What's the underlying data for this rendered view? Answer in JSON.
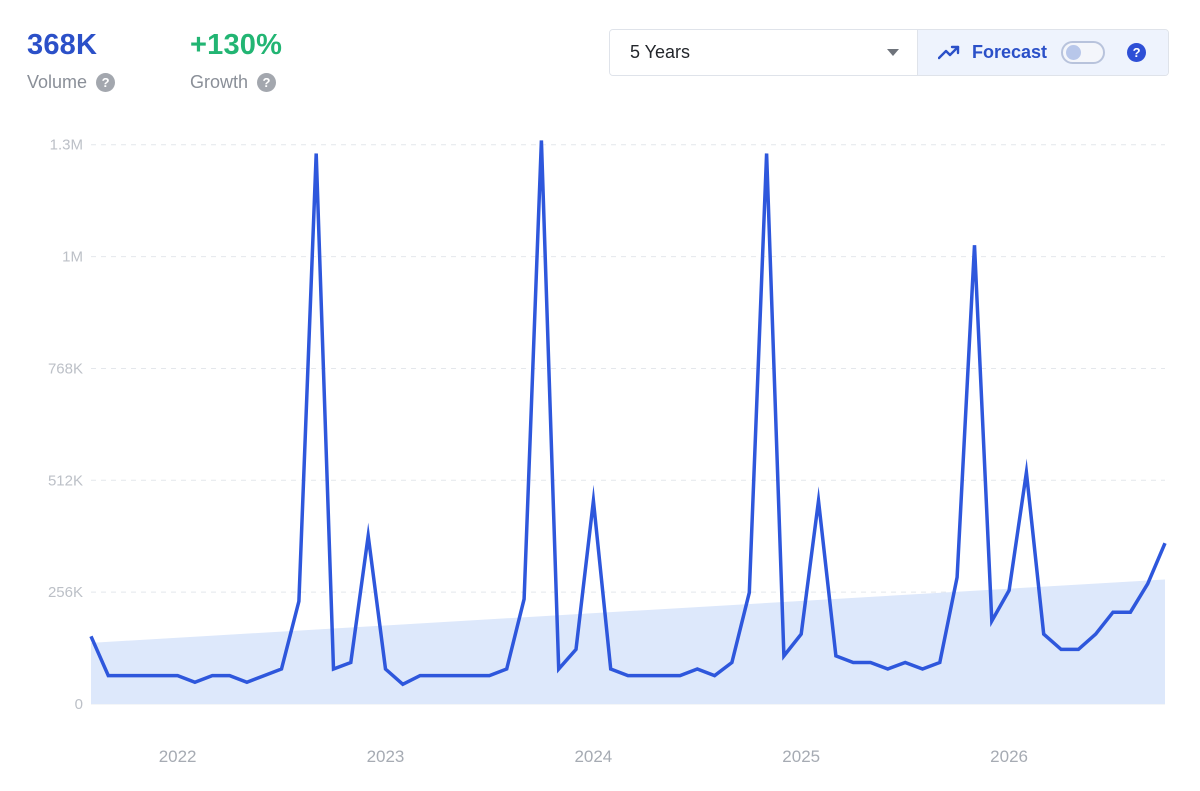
{
  "metrics": {
    "volume": {
      "value": "368K",
      "label": "Volume",
      "color": "#2b50c8"
    },
    "growth": {
      "value": "+130%",
      "label": "Growth",
      "color": "#22b573"
    }
  },
  "controls": {
    "range_selected": "5 Years",
    "forecast_label": "Forecast",
    "forecast_enabled": false
  },
  "colors": {
    "line": "#2e57dc",
    "trend_fill": "#dde8fb",
    "grid": "#e4e7ec"
  },
  "chart_data": {
    "type": "line",
    "series": [
      {
        "values": [
          155000,
          65000,
          65000,
          65000,
          65000,
          65000,
          50000,
          65000,
          65000,
          50000,
          65000,
          80000,
          235000,
          1260000,
          80000,
          95000,
          385000,
          80000,
          45000,
          65000,
          65000,
          65000,
          65000,
          65000,
          80000,
          240000,
          1290000,
          80000,
          125000,
          465000,
          80000,
          65000,
          65000,
          65000,
          65000,
          80000,
          65000,
          95000,
          255000,
          1260000,
          110000,
          160000,
          465000,
          110000,
          95000,
          95000,
          80000,
          95000,
          80000,
          95000,
          290000,
          1050000,
          190000,
          260000,
          530000,
          160000,
          125000,
          125000,
          160000,
          210000,
          210000,
          275000,
          368000
        ]
      }
    ],
    "trend": {
      "start": 140000,
      "end": 285000
    },
    "x_labels": [
      "2022",
      "2023",
      "2024",
      "2025",
      "2026"
    ],
    "x_label_index": [
      5,
      17,
      29,
      41,
      53
    ],
    "ylim": [
      0,
      1300000
    ],
    "y_ticks": [
      {
        "value": 0,
        "label": "0"
      },
      {
        "value": 256000,
        "label": "256K"
      },
      {
        "value": 512000,
        "label": "512K"
      },
      {
        "value": 768000,
        "label": "768K"
      },
      {
        "value": 1024000,
        "label": "1M"
      },
      {
        "value": 1280000,
        "label": "1.3M"
      }
    ],
    "grid": true
  }
}
